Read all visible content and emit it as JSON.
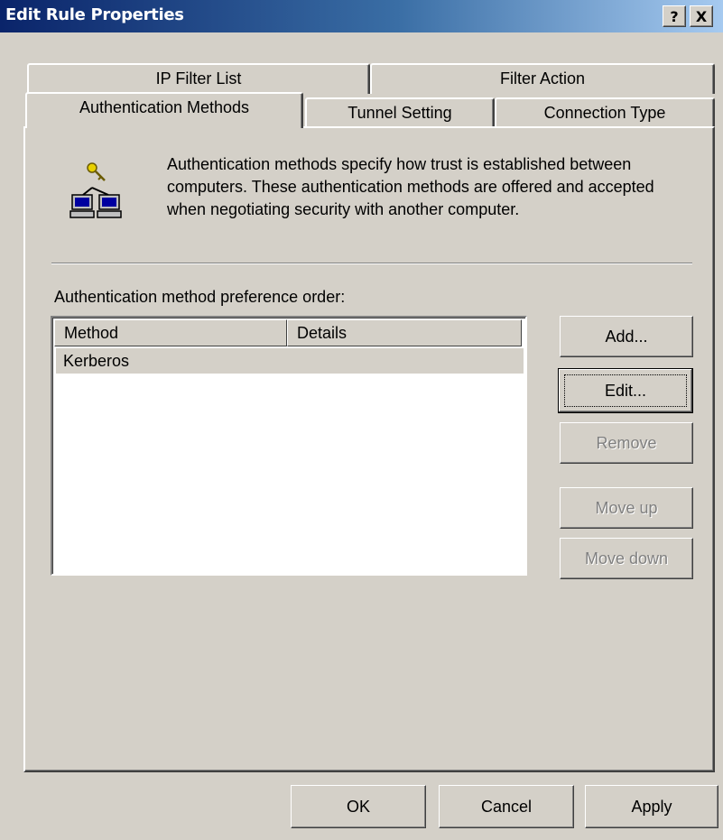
{
  "window": {
    "title": "Edit Rule Properties",
    "help_glyph": "?",
    "close_glyph": "X"
  },
  "tabs": {
    "back_row": [
      "IP Filter List",
      "Filter Action"
    ],
    "front_row": [
      "Authentication Methods",
      "Tunnel Setting",
      "Connection Type"
    ],
    "active": "Authentication Methods"
  },
  "panel": {
    "icon": "networked-computers-key-icon",
    "description": "Authentication methods specify how trust is established between computers. These authentication methods are offered and accepted when negotiating security with another computer.",
    "list_label": "Authentication method preference order:",
    "columns": [
      "Method",
      "Details"
    ],
    "rows": [
      {
        "method": "Kerberos",
        "details": ""
      }
    ],
    "side_buttons": {
      "add": "Add...",
      "edit": "Edit...",
      "remove": "Remove",
      "move_up": "Move up",
      "move_down": "Move down"
    }
  },
  "footer": {
    "ok": "OK",
    "cancel": "Cancel",
    "apply": "Apply"
  },
  "colors": {
    "dialog_face": "#d4d0c8",
    "title_gradient_start": "#0a246a",
    "title_gradient_end": "#a6caf0",
    "disabled_text": "#808080"
  }
}
